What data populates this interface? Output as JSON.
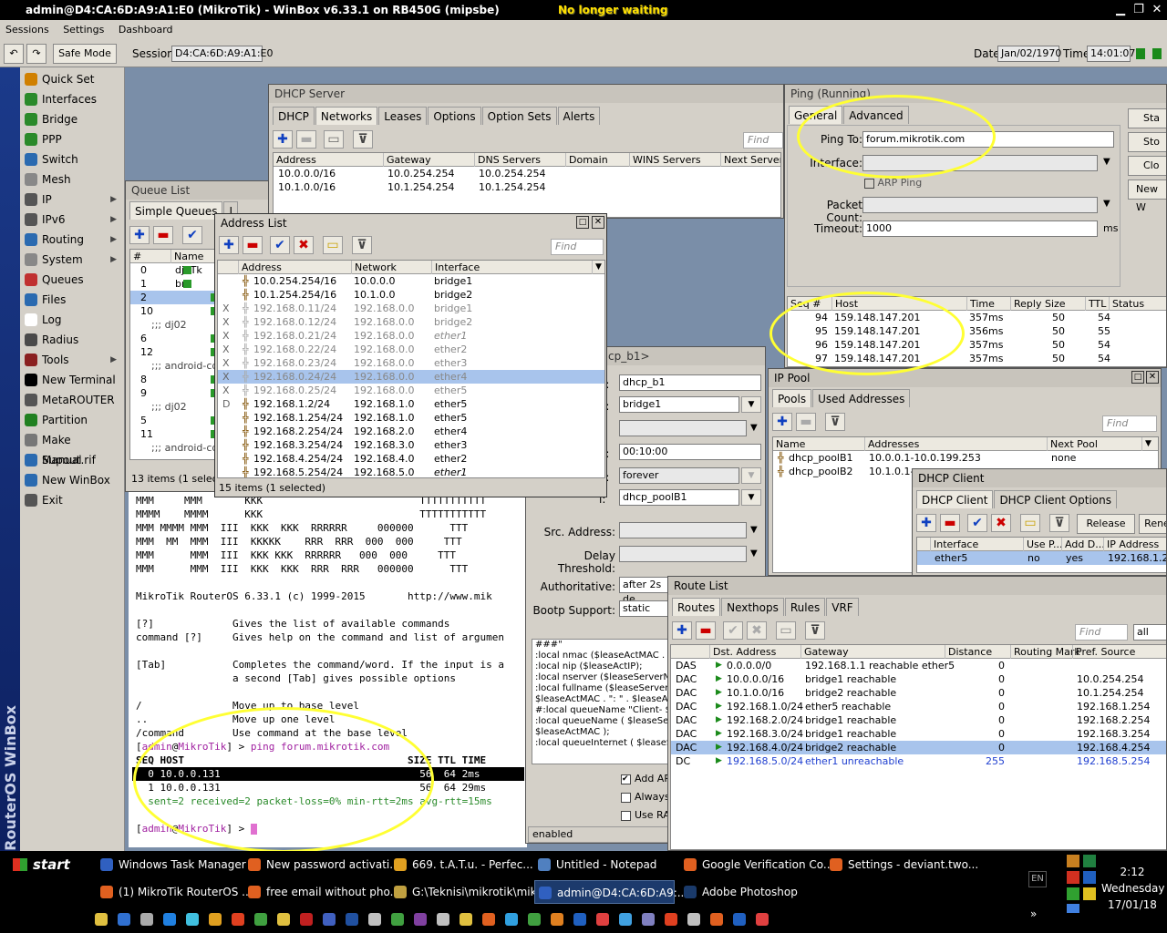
{
  "titlebar": {
    "title": "admin@D4:CA:6D:A9:A1:E0 (MikroTik) - WinBox v6.33.1 on RB450G (mipsbe)",
    "banner": "No longer waiting"
  },
  "menu": [
    "Sessions",
    "Settings",
    "Dashboard"
  ],
  "toolbar": {
    "safe_mode": "Safe Mode",
    "session_label": "Session:",
    "session_value": "D4:CA:6D:A9:A1:E0",
    "date_label": "Date:",
    "date_value": "Jan/02/1970",
    "time_label": "Time:",
    "time_value": "14:01:07"
  },
  "sidebar": {
    "brand": "RouterOS WinBox",
    "items": [
      {
        "label": "Quick Set",
        "icon": "quick-set-icon",
        "color": "#d08000",
        "sub": false
      },
      {
        "label": "Interfaces",
        "icon": "interfaces-icon",
        "color": "#2a8a2a",
        "sub": false
      },
      {
        "label": "Bridge",
        "icon": "bridge-icon",
        "color": "#2a8a2a",
        "sub": false
      },
      {
        "label": "PPP",
        "icon": "ppp-icon",
        "color": "#2a8a2a",
        "sub": false
      },
      {
        "label": "Switch",
        "icon": "switch-icon",
        "color": "#2a6ab0",
        "sub": false
      },
      {
        "label": "Mesh",
        "icon": "mesh-icon",
        "color": "#888888",
        "sub": false
      },
      {
        "label": "IP",
        "icon": "ip-icon",
        "color": "#555555",
        "sub": true
      },
      {
        "label": "IPv6",
        "icon": "ipv6-icon",
        "color": "#555555",
        "sub": true
      },
      {
        "label": "Routing",
        "icon": "routing-icon",
        "color": "#2a6ab0",
        "sub": true
      },
      {
        "label": "System",
        "icon": "system-icon",
        "color": "#888888",
        "sub": true
      },
      {
        "label": "Queues",
        "icon": "queues-icon",
        "color": "#c03030",
        "sub": false
      },
      {
        "label": "Files",
        "icon": "files-icon",
        "color": "#2a6ab0",
        "sub": false
      },
      {
        "label": "Log",
        "icon": "log-icon",
        "color": "#ffffff",
        "sub": false
      },
      {
        "label": "Radius",
        "icon": "radius-icon",
        "color": "#4a4a4a",
        "sub": false
      },
      {
        "label": "Tools",
        "icon": "tools-icon",
        "color": "#8a2020",
        "sub": true
      },
      {
        "label": "New Terminal",
        "icon": "terminal-icon",
        "color": "#000000",
        "sub": false
      },
      {
        "label": "MetaROUTER",
        "icon": "metarouter-icon",
        "color": "#555555",
        "sub": false
      },
      {
        "label": "Partition",
        "icon": "partition-icon",
        "color": "#208020",
        "sub": false
      },
      {
        "label": "Make Supout.rif",
        "icon": "supout-icon",
        "color": "#777777",
        "sub": false
      },
      {
        "label": "Manual",
        "icon": "manual-icon",
        "color": "#2a6ab0",
        "sub": false
      },
      {
        "label": "New WinBox",
        "icon": "winbox-icon",
        "color": "#2a6ab0",
        "sub": false
      },
      {
        "label": "Exit",
        "icon": "exit-icon",
        "color": "#555555",
        "sub": false
      }
    ]
  },
  "dhcp_server": {
    "title": "DHCP Server",
    "tabs": [
      "DHCP",
      "Networks",
      "Leases",
      "Options",
      "Option Sets",
      "Alerts"
    ],
    "find": "Find",
    "cols": [
      "Address",
      "Gateway",
      "DNS Servers",
      "Domain",
      "WINS Servers",
      "Next Server"
    ],
    "rows": [
      [
        "10.0.0.0/16",
        "10.0.254.254",
        "10.0.254.254"
      ],
      [
        "10.1.0.0/16",
        "10.1.254.254",
        "10.1.254.254"
      ]
    ]
  },
  "queue_list": {
    "title": "Queue List",
    "tabs": [
      "Simple Queues",
      "I"
    ],
    "cols": [
      "#",
      "Name"
    ],
    "rows": [
      [
        "0",
        "djATk"
      ],
      [
        "1",
        "bri"
      ],
      [
        "2",
        ""
      ],
      [
        "10",
        ""
      ],
      [
        "",
        ";;; dj02"
      ],
      [
        "6",
        ""
      ],
      [
        "12",
        ""
      ],
      [
        "",
        ";;; android-cd61"
      ],
      [
        "8",
        ""
      ],
      [
        "9",
        ""
      ],
      [
        "",
        ";;; dj02"
      ],
      [
        "5",
        ""
      ],
      [
        "11",
        ""
      ],
      [
        "",
        ";;; android-cd61"
      ]
    ],
    "status": "13 items (1 selecte"
  },
  "address_list": {
    "title": "Address List",
    "find": "Find",
    "cols": [
      "Address",
      "Network",
      "Interface"
    ],
    "rows": [
      {
        "flag": "",
        "addr": "10.0.254.254/16",
        "net": "10.0.0.0",
        "iface": "bridge1",
        "dis": false
      },
      {
        "flag": "",
        "addr": "10.1.254.254/16",
        "net": "10.1.0.0",
        "iface": "bridge2",
        "dis": false
      },
      {
        "flag": "X",
        "addr": "192.168.0.11/24",
        "net": "192.168.0.0",
        "iface": "bridge1",
        "dis": true
      },
      {
        "flag": "X",
        "addr": "192.168.0.12/24",
        "net": "192.168.0.0",
        "iface": "bridge2",
        "dis": true
      },
      {
        "flag": "X",
        "addr": "192.168.0.21/24",
        "net": "192.168.0.0",
        "iface": "ether1",
        "dis": true
      },
      {
        "flag": "X",
        "addr": "192.168.0.22/24",
        "net": "192.168.0.0",
        "iface": "ether2",
        "dis": true
      },
      {
        "flag": "X",
        "addr": "192.168.0.23/24",
        "net": "192.168.0.0",
        "iface": "ether3",
        "dis": true
      },
      {
        "flag": "X",
        "addr": "192.168.0.24/24",
        "net": "192.168.0.0",
        "iface": "ether4",
        "dis": true,
        "sel": true
      },
      {
        "flag": "X",
        "addr": "192.168.0.25/24",
        "net": "192.168.0.0",
        "iface": "ether5",
        "dis": true
      },
      {
        "flag": "D",
        "addr": "192.168.1.2/24",
        "net": "192.168.1.0",
        "iface": "ether5",
        "dis": false
      },
      {
        "flag": "",
        "addr": "192.168.1.254/24",
        "net": "192.168.1.0",
        "iface": "ether5",
        "dis": false
      },
      {
        "flag": "",
        "addr": "192.168.2.254/24",
        "net": "192.168.2.0",
        "iface": "ether4",
        "dis": false
      },
      {
        "flag": "",
        "addr": "192.168.3.254/24",
        "net": "192.168.3.0",
        "iface": "ether3",
        "dis": false
      },
      {
        "flag": "",
        "addr": "192.168.4.254/24",
        "net": "192.168.4.0",
        "iface": "ether2",
        "dis": false
      },
      {
        "flag": "",
        "addr": "192.168.5.254/24",
        "net": "192.168.5.0",
        "iface": "ether1",
        "dis": false
      }
    ],
    "status": "15 items (1 selected)"
  },
  "ping": {
    "title": "Ping (Running)",
    "tabs": [
      "General",
      "Advanced"
    ],
    "ping_to_label": "Ping To:",
    "ping_to": "forum.mikrotik.com",
    "interface_label": "Interface:",
    "arp_ping": "ARP Ping",
    "packet_count_label": "Packet Count:",
    "timeout_label": "Timeout:",
    "timeout": "1000",
    "unit": "ms",
    "buttons": [
      "Sta",
      "Sto",
      "Clo",
      "New W"
    ],
    "cols": [
      "Seq #",
      "Host",
      "Time",
      "Reply Size",
      "TTL",
      "Status"
    ],
    "rows": [
      [
        "94",
        "159.148.147.201",
        "357ms",
        "50",
        "54"
      ],
      [
        "95",
        "159.148.147.201",
        "356ms",
        "50",
        "55"
      ],
      [
        "96",
        "159.148.147.201",
        "357ms",
        "50",
        "54"
      ],
      [
        "97",
        "159.148.147.201",
        "357ms",
        "50",
        "54"
      ]
    ]
  },
  "dhcp_edit": {
    "title": "cp_b1>",
    "name": "dhcp_b1",
    "interface": "bridge1",
    "lease_time": "00:10:00",
    "lease_mode": "forever",
    "pool": "dhcp_poolB1",
    "src_label": "Src. Address:",
    "delay_label": "Delay Threshold:",
    "auth_label": "Authoritative:",
    "auth": "after 2s de",
    "bootp_label": "Bootp Support:",
    "bootp": "static",
    "script": [
      "###\"",
      ":local nmac ($leaseActMAC . \"",
      ":local nip ($leaseActIP);",
      ":local nserver ($leaseServerN",
      ":local fullname ($leaseServerN",
      "$leaseActMAC . \": \" . $leaseA",
      "#:local queueName \"Client- $k",
      ":local queueName ( $leaseSer",
      "$leaseActMAC );",
      ":local queueInternet ( $leaseS"
    ],
    "checks": [
      "Add AR",
      "Always",
      "Use RA"
    ],
    "status": "enabled"
  },
  "ip_pool": {
    "title": "IP Pool",
    "tabs": [
      "Pools",
      "Used Addresses"
    ],
    "find": "Find",
    "cols": [
      "Name",
      "Addresses",
      "Next Pool"
    ],
    "rows": [
      [
        "dhcp_poolB1",
        "10.0.0.1-10.0.199.253",
        "none"
      ],
      [
        "dhcp_poolB2",
        "10.1.0.1-",
        ""
      ]
    ]
  },
  "dhcp_client": {
    "title": "DHCP Client",
    "tabs": [
      "DHCP Client",
      "DHCP Client Options"
    ],
    "release": "Release",
    "renew": "Rene",
    "cols": [
      "Interface",
      "Use P...",
      "Add D...",
      "IP Address"
    ],
    "rows": [
      [
        "ether5",
        "no",
        "yes",
        "192.168.1.2/"
      ]
    ]
  },
  "route_list": {
    "title": "Route List",
    "tabs": [
      "Routes",
      "Nexthops",
      "Rules",
      "VRF"
    ],
    "find": "Find",
    "filter": "all",
    "cols": [
      "Dst. Address",
      "Gateway",
      "Distance",
      "Routing Mark",
      "Pref. Source"
    ],
    "rows": [
      {
        "flag": "DAS",
        "dst": "0.0.0.0/0",
        "gw": "192.168.1.1 reachable ether5",
        "dist": "0",
        "src": ""
      },
      {
        "flag": "DAC",
        "dst": "10.0.0.0/16",
        "gw": "bridge1 reachable",
        "dist": "0",
        "src": "10.0.254.254"
      },
      {
        "flag": "DAC",
        "dst": "10.1.0.0/16",
        "gw": "bridge2 reachable",
        "dist": "0",
        "src": "10.1.254.254"
      },
      {
        "flag": "DAC",
        "dst": "192.168.1.0/24",
        "gw": "ether5 reachable",
        "dist": "0",
        "src": "192.168.1.254"
      },
      {
        "flag": "DAC",
        "dst": "192.168.2.0/24",
        "gw": "bridge1 reachable",
        "dist": "0",
        "src": "192.168.2.254"
      },
      {
        "flag": "DAC",
        "dst": "192.168.3.0/24",
        "gw": "bridge1 reachable",
        "dist": "0",
        "src": "192.168.3.254"
      },
      {
        "flag": "DAC",
        "dst": "192.168.4.0/24",
        "gw": "bridge2 reachable",
        "dist": "0",
        "src": "192.168.4.254",
        "sel": true
      },
      {
        "flag": "DC",
        "dst": "192.168.5.0/24",
        "gw": "ether1 unreachable",
        "dist": "255",
        "src": "192.168.5.254",
        "blue": true
      }
    ]
  },
  "terminal": {
    "lines": [
      "MMM     MMM       KKK                          TTTTTTTTTTT",
      "MMMM    MMMM      KKK                          TTTTTTTTTTT",
      "MMM MMMM MMM  III  KKK  KKK  RRRRRR     000000      TTT",
      "MMM  MM  MMM  III  KKKKK    RRR  RRR  000  000     TTT",
      "MMM      MMM  III  KKK KKK  RRRRRR   000  000     TTT",
      "MMM      MMM  III  KKK  KKK  RRR  RRR   000000      TTT",
      "",
      "MikroTik RouterOS 6.33.1 (c) 1999-2015       http://www.mik",
      "",
      "[?]             Gives the list of available commands",
      "command [?]     Gives help on the command and list of argumen",
      "",
      "[Tab]           Completes the command/word. If the input is a",
      "                a second [Tab] gives possible options",
      "",
      "/               Move up to base level",
      "..              Move up one level",
      "/command        Use command at the base level"
    ],
    "prompt_user": "admin",
    "prompt_host": "MikroTik",
    "prompt_cmd": "ping forum.mikrotik.com",
    "ping_head": "SEQ HOST                                     SIZE TTL TIME",
    "ping_row0": "  0 10.0.0.131                                 56  64 2ms",
    "ping_row1": "  1 10.0.0.131                                 56  64 29ms",
    "ping_stats": "  sent=2 received=2 packet-loss=0% min-rtt=2ms avg-rtt=15ms"
  },
  "taskbar": {
    "start": "start",
    "row1": [
      "Windows Task Manager",
      "New password activati...",
      "669. t.A.T.u. - Perfec...",
      "Untitled - Notepad",
      "Google Verification Co...",
      "Settings - deviant.two..."
    ],
    "row2": [
      "(1) MikroTik RouterOS ...",
      "free email without pho...",
      "G:\\Teknisi\\mikrotik\\mik...",
      "admin@D4:CA:6D:A9:...",
      "Adobe Photoshop"
    ],
    "lang": "EN",
    "clock": "2:12",
    "day": "Wednesday",
    "date": "17/01/18"
  }
}
